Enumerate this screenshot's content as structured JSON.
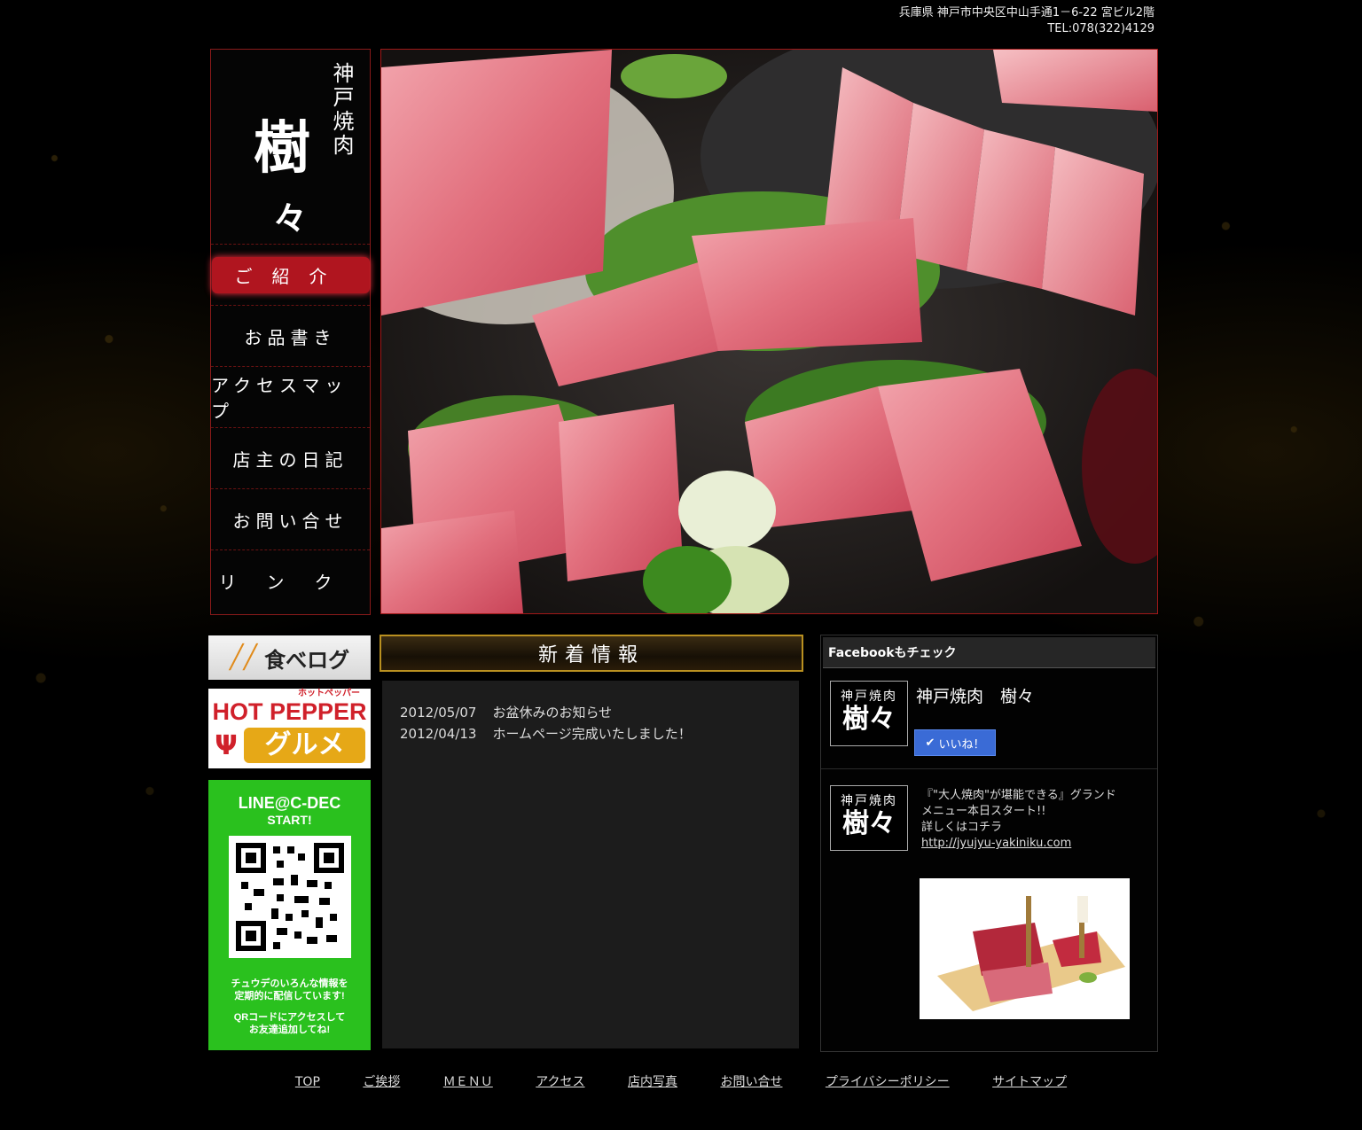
{
  "header": {
    "address": "兵庫県 神戸市中央区中山手通1－6-22 宮ビル2階",
    "tel": "TEL:078(322)4129"
  },
  "logo": {
    "subtitle": "神戸焼肉",
    "name_1": "樹",
    "name_2": "々"
  },
  "nav": {
    "items": [
      {
        "label": "ご紹介",
        "active": true
      },
      {
        "label": "お品書き"
      },
      {
        "label": "アクセスマップ"
      },
      {
        "label": "店主の日記"
      },
      {
        "label": "お問い合せ"
      },
      {
        "label": "リンク"
      }
    ]
  },
  "banners": {
    "tabelog": "食べログ",
    "hotpepper_top": "ホットペッパー",
    "hotpepper_main": "HOT PEPPER",
    "hotpepper_sub": "グルメ",
    "line_title": "LINE@C-DEC",
    "line_title2": "START!",
    "line_text1": "チュウデのいろんな情報を",
    "line_text2": "定期的に配信しています!",
    "line_text3": "QRコードにアクセスして",
    "line_text4": "お友達追加してね!"
  },
  "news": {
    "heading": "新着情報",
    "items": [
      {
        "date": "2012/05/07",
        "text": "お盆休みのお知らせ"
      },
      {
        "date": "2012/04/13",
        "text": "ホームページ完成いたしました！"
      }
    ]
  },
  "facebook": {
    "heading": "Facebookもチェック",
    "logo_a": "神戸焼肉",
    "logo_b": "樹々",
    "page_name": "神戸焼肉　樹々",
    "like_label": "いいね！",
    "post_line1": "『\"大人焼肉\"が堪能できる』グランド",
    "post_line2": "メニュー本日スタート!!",
    "post_line3": "詳しくはコチラ",
    "post_link": "http://jyujyu-yakiniku.com"
  },
  "footer": {
    "links": [
      "TOP",
      "ご挨拶",
      "ＭＥＮＵ",
      "アクセス",
      "店内写真",
      "お問い合せ",
      "プライバシーポリシー",
      "サイトマップ"
    ]
  },
  "colors": {
    "accent_red": "#b0151f",
    "border_red": "#8a1a1a",
    "line_green": "#2ac11e",
    "gold": "#b99020"
  }
}
